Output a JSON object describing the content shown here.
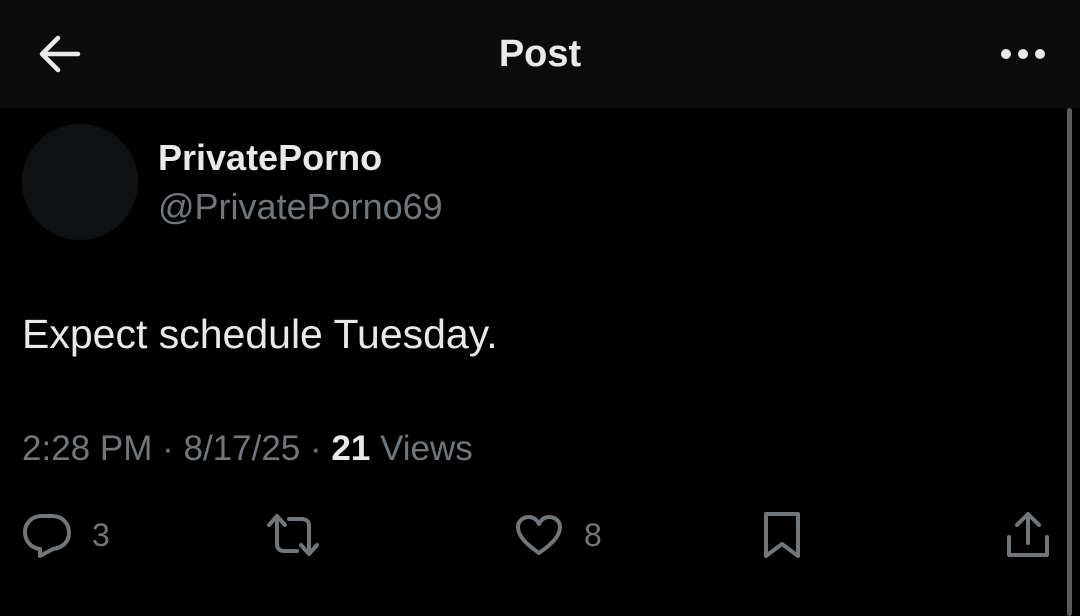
{
  "header": {
    "title": "Post",
    "back_icon": "arrow-left-icon",
    "more_icon": "more-horizontal-icon"
  },
  "post": {
    "display_name": "PrivatePorno",
    "handle": "@PrivatePorno69",
    "text": "Expect schedule Tuesday.",
    "time": "2:28 PM",
    "separator": "·",
    "date": "8/17/25",
    "views_count": "21",
    "views_label": "Views"
  },
  "actions": {
    "reply": {
      "icon": "reply-icon",
      "count": "3"
    },
    "repost": {
      "icon": "repost-icon",
      "count": ""
    },
    "like": {
      "icon": "heart-icon",
      "count": "8"
    },
    "bookmark": {
      "icon": "bookmark-icon"
    },
    "share": {
      "icon": "share-icon"
    }
  },
  "colors": {
    "background": "#000000",
    "header_background": "#0b0b0b",
    "primary_text": "#e7e9ea",
    "secondary_text": "#71767b"
  }
}
